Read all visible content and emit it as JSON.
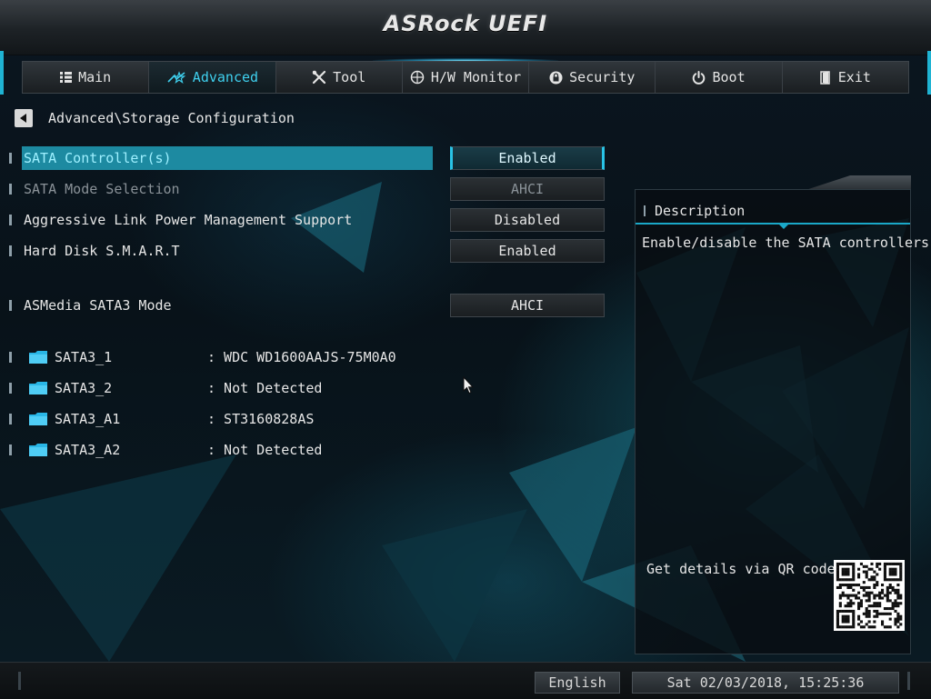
{
  "header": {
    "logo": "ASRock UEFI"
  },
  "tabs": [
    {
      "label": "Main",
      "icon": "list-icon",
      "active": false
    },
    {
      "label": "Advanced",
      "icon": "star-icon",
      "active": true
    },
    {
      "label": "Tool",
      "icon": "tools-icon",
      "active": false
    },
    {
      "label": "H/W Monitor",
      "icon": "monitor-icon",
      "active": false
    },
    {
      "label": "Security",
      "icon": "shield-icon",
      "active": false
    },
    {
      "label": "Boot",
      "icon": "power-icon",
      "active": false
    },
    {
      "label": "Exit",
      "icon": "exit-icon",
      "active": false
    }
  ],
  "breadcrumb": {
    "path": "Advanced\\Storage Configuration"
  },
  "settings": [
    {
      "label": "SATA Controller(s)",
      "value": "Enabled",
      "selected": true
    },
    {
      "label": "SATA Mode Selection",
      "value": "AHCI",
      "dimmed": true
    },
    {
      "label": "Aggressive Link Power Management Support",
      "value": "Disabled"
    },
    {
      "label": "Hard Disk S.M.A.R.T",
      "value": "Enabled"
    },
    {
      "label": "ASMedia SATA3 Mode",
      "value": "AHCI"
    }
  ],
  "drives": [
    {
      "port": "SATA3_1",
      "device": ": WDC WD1600AAJS-75M0A0"
    },
    {
      "port": "SATA3_2",
      "device": ": Not Detected"
    },
    {
      "port": "SATA3_A1",
      "device": ": ST3160828AS"
    },
    {
      "port": "SATA3_A2",
      "device": ": Not Detected"
    }
  ],
  "description": {
    "title": "Description",
    "text": "Enable/disable the SATA controllers.",
    "qr_label": "Get details via QR code"
  },
  "footer": {
    "language": "English",
    "datetime": "Sat 02/03/2018, 15:25:36"
  },
  "colors": {
    "accent": "#1d8aa1",
    "highlight_text": "#9ef0ff",
    "active_tab": "#3fd0ee"
  }
}
